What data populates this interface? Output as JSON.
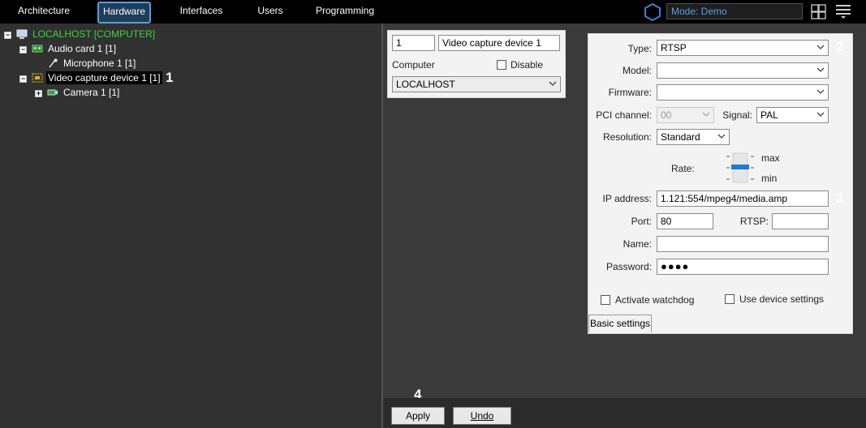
{
  "nav": {
    "tabs": [
      "Architecture",
      "Hardware",
      "Interfaces",
      "Users",
      "Programming"
    ],
    "active": "Hardware"
  },
  "header": {
    "mode_label": "Mode: Demo",
    "accent": "#5aa0e6"
  },
  "tree": {
    "root": "LOCALHOST [COMPUTER]",
    "audio_card": "Audio card 1 [1]",
    "microphone": "Microphone 1 [1]",
    "video_capture": "Video capture device 1 [1]",
    "camera": "Camera 1 [1]",
    "root_color": "#3cd33c"
  },
  "object_panel": {
    "id": "1",
    "name": "Video capture device 1",
    "computer_label": "Computer",
    "disable_label": "Disable",
    "computer_value": "LOCALHOST"
  },
  "settings": {
    "type_label": "Type:",
    "type_value": "RTSP",
    "model_label": "Model:",
    "model_value": "",
    "firmware_label": "Firmware:",
    "firmware_value": "",
    "pci_label": "PCI channel:",
    "pci_value": "00",
    "signal_label": "Signal:",
    "signal_value": "PAL",
    "resolution_label": "Resolution:",
    "resolution_value": "Standard",
    "rate_label": "Rate:",
    "rate_max": "max",
    "rate_min": "min",
    "ip_label": "IP address:",
    "ip_value": "1.121:554/mpeg4/media.amp",
    "port_label": "Port:",
    "port_value": "80",
    "rtsp_label": "RTSP:",
    "rtsp_value": "",
    "name_label": "Name:",
    "name_value": "",
    "password_label": "Password:",
    "password_value": "●●●●",
    "watchdog_label": "Activate watchdog",
    "use_device_label": "Use device settings",
    "basic_tab": "Basic settings"
  },
  "footer": {
    "apply": "Apply",
    "undo": "Undo"
  },
  "callouts": [
    "1",
    "2",
    "3",
    "4"
  ]
}
